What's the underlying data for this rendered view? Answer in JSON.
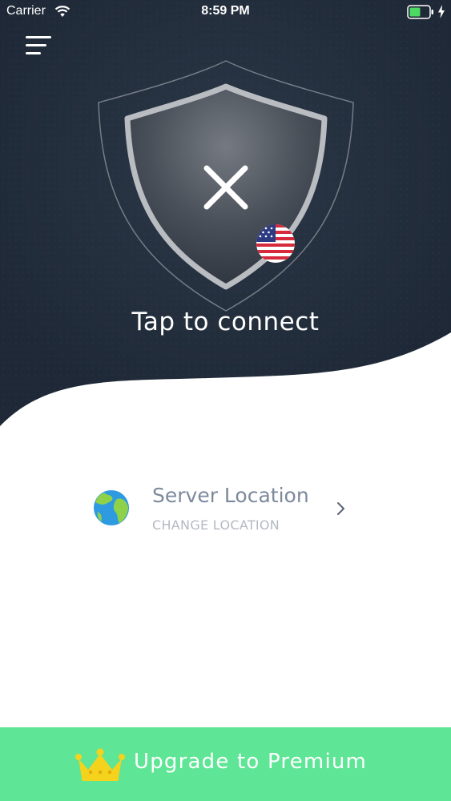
{
  "status_bar": {
    "carrier": "Carrier",
    "time": "8:59 PM",
    "icons": [
      "wifi-icon",
      "battery-icon",
      "charging-icon"
    ]
  },
  "header": {
    "menu_icon": "hamburger-menu-icon"
  },
  "connect": {
    "status_icon": "close-x-icon",
    "country_flag": "us-flag-icon",
    "label": "Tap to connect"
  },
  "server": {
    "icon": "globe-icon",
    "title": "Server Location",
    "subtitle": "CHANGE LOCATION",
    "arrow_icon": "chevron-right-icon"
  },
  "upgrade": {
    "icon": "crown-icon",
    "label": "Upgrade to Premium"
  },
  "colors": {
    "hero_bg": "#232e3e",
    "accent_green": "#5ee595",
    "server_title": "#7d8a9c",
    "server_subtitle": "#b4b9c1",
    "crown": "#f5d21c"
  }
}
